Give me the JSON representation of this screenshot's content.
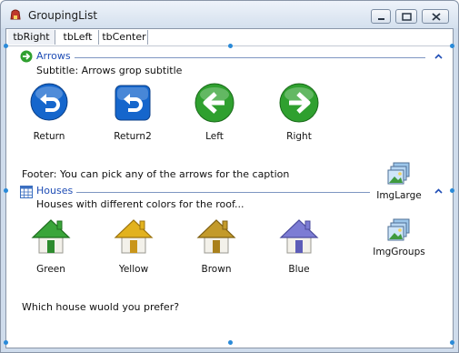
{
  "window": {
    "title": "GroupingList"
  },
  "tabs": [
    "tbRight",
    "tbLeft",
    "tbCenter"
  ],
  "groups": [
    {
      "title": "Arrows",
      "subtitle": "Subtitle: Arrows grop subtitle",
      "footer": "Footer: You can pick any of the arrows for the caption",
      "items": [
        {
          "label": "Return",
          "icon": "return-round-icon"
        },
        {
          "label": "Return2",
          "icon": "return-square-icon"
        },
        {
          "label": "Left",
          "icon": "left-arrow-icon"
        },
        {
          "label": "Right",
          "icon": "right-arrow-icon"
        }
      ]
    },
    {
      "title": "Houses",
      "subtitle": "Houses with different colors for the roof...",
      "footer": "Which house wuold you prefer?",
      "items": [
        {
          "label": "Green",
          "icon": "house-green-icon",
          "roof": "#3aa53a"
        },
        {
          "label": "Yellow",
          "icon": "house-yellow-icon",
          "roof": "#e2b21e"
        },
        {
          "label": "Brown",
          "icon": "house-brown-icon",
          "roof": "#c39a2a"
        },
        {
          "label": "Blue",
          "icon": "house-blue-icon",
          "roof": "#7c7cd4"
        }
      ]
    }
  ],
  "side_buttons": [
    {
      "label": "ImgLarge",
      "icon": "image-stack-icon"
    },
    {
      "label": "ImgGroups",
      "icon": "image-stack-icon"
    }
  ],
  "colors": {
    "accent": "#1f4db5",
    "selection_handle": "#2a8ad8",
    "arrow_blue": "#1566cc",
    "arrow_green": "#2fa02f"
  }
}
